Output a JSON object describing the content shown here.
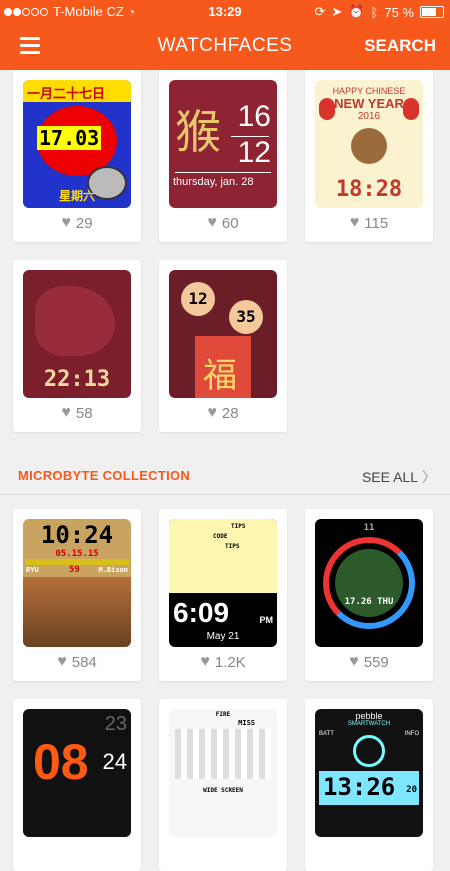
{
  "status_bar": {
    "carrier": "T-Mobile CZ",
    "time": "13:29",
    "battery_text": "75 %",
    "battery_level": 0.75
  },
  "app_bar": {
    "title": "WATCHFACES",
    "search_label": "SEARCH"
  },
  "watchfaces": [
    {
      "likes": "29",
      "face_text": "17.03",
      "face_top": "一月二十七日",
      "face_bottom": "星期六"
    },
    {
      "likes": "60",
      "face_hour": "16",
      "face_min": "12",
      "face_char": "猴",
      "face_date": "thursday, jan. 28"
    },
    {
      "likes": "115",
      "face_top": "HAPPY CHINESE",
      "face_mid": "NEW YEAR",
      "face_year": "2016",
      "face_time": "18:28"
    },
    {
      "likes": "58",
      "face_time": "22:13"
    },
    {
      "likes": "28",
      "face_h": "12",
      "face_m": "35",
      "face_char": "福"
    }
  ],
  "collection": {
    "title": "MICROBYTE COLLECTION",
    "see_all": "SEE ALL",
    "items": [
      {
        "likes": "584",
        "face_time": "10:24",
        "face_date": "05.15.15",
        "p1": "RYU",
        "p2": "M.Bison",
        "round": "59"
      },
      {
        "likes": "1.2K",
        "face_time": "6:09",
        "face_ampm": "PM",
        "face_date": "May 21",
        "labels": [
          "TIPS",
          "CODE",
          "TIPS"
        ]
      },
      {
        "likes": "559",
        "face_time": "17.26 THU",
        "face_num": "11"
      },
      {
        "face_h1": "08",
        "face_h2": "23",
        "face_h3": "24"
      },
      {
        "face_top": "FIRE",
        "face_mid": "MISS",
        "face_bottom": "WIDE SCREEN"
      },
      {
        "brand": "pebble",
        "sub": "SMARTWATCH",
        "batt": "BATT",
        "info": "INFO",
        "face_time": "13:26",
        "sec": "20"
      }
    ]
  },
  "colors": {
    "accent": "#f7581c",
    "background": "#f0f0f0"
  }
}
